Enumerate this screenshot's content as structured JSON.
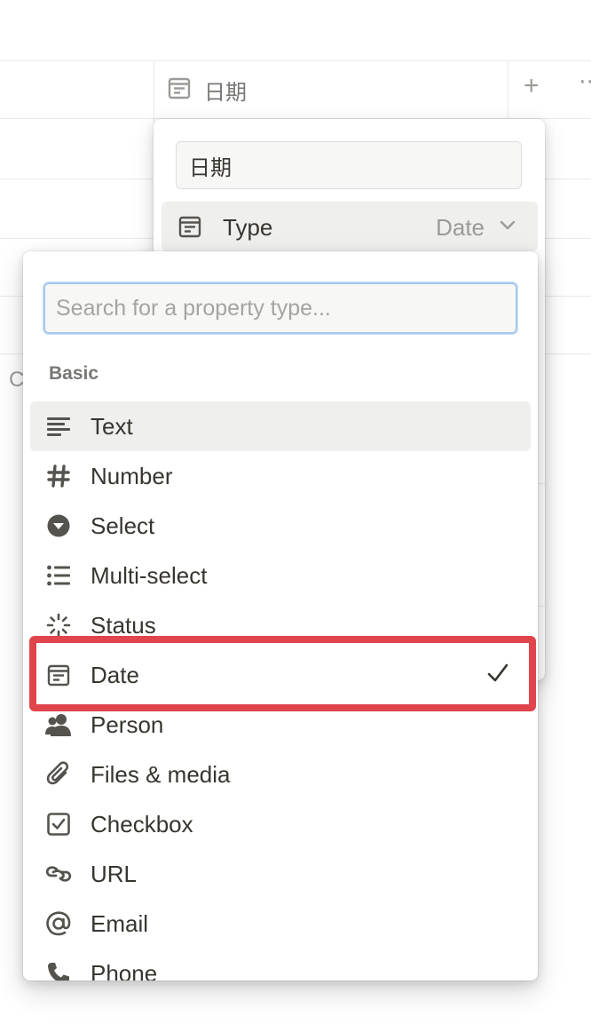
{
  "table": {
    "column_header": {
      "icon": "calendar-icon",
      "label": "日期"
    },
    "add_column_icon": "+",
    "more_icon": "⋯",
    "peek_text": "C"
  },
  "property_panel": {
    "name_value": "日期",
    "type_label": "Type",
    "type_value": "Date",
    "type_icon": "calendar-icon",
    "chevron_icon": "chevron-down-icon"
  },
  "type_menu": {
    "search_placeholder": "Search for a property type...",
    "section_label": "Basic",
    "items": [
      {
        "label": "Text",
        "icon": "text-lines-icon"
      },
      {
        "label": "Number",
        "icon": "hash-icon"
      },
      {
        "label": "Select",
        "icon": "select-icon"
      },
      {
        "label": "Multi-select",
        "icon": "list-icon"
      },
      {
        "label": "Status",
        "icon": "status-icon"
      },
      {
        "label": "Date",
        "icon": "calendar-icon",
        "selected": true
      },
      {
        "label": "Person",
        "icon": "person-icon"
      },
      {
        "label": "Files & media",
        "icon": "paperclip-icon"
      },
      {
        "label": "Checkbox",
        "icon": "checkbox-icon"
      },
      {
        "label": "URL",
        "icon": "link-icon"
      },
      {
        "label": "Email",
        "icon": "at-icon"
      },
      {
        "label": "Phone",
        "icon": "phone-icon"
      }
    ],
    "selected_index": 5,
    "hovered_index": 0
  },
  "colors": {
    "highlight": "#e0444c",
    "icon": "#55534e",
    "muted_text": "#9b9a97",
    "focus_border": "#a6c8ea"
  }
}
